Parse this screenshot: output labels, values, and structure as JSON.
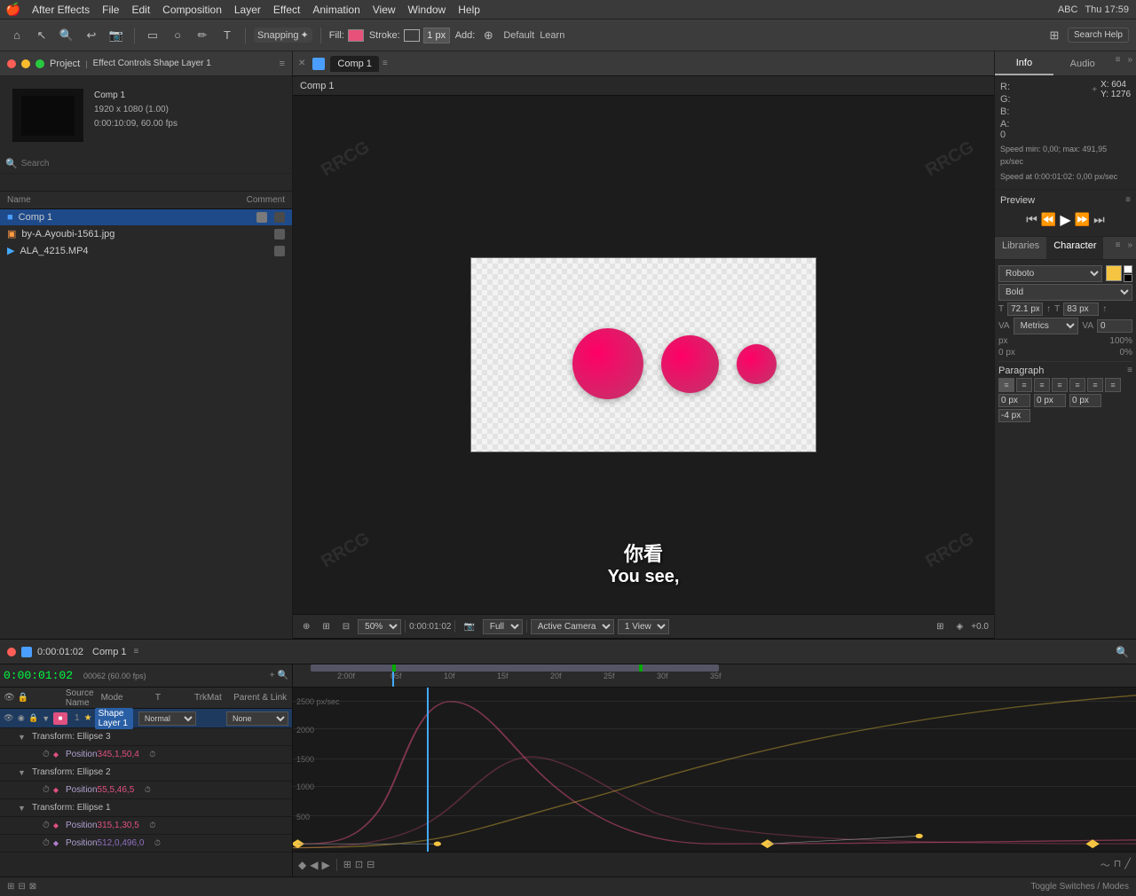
{
  "menubar": {
    "apple": "🍎",
    "items": [
      "After Effects",
      "File",
      "Edit",
      "Composition",
      "Layer",
      "Effect",
      "Animation",
      "View",
      "Window",
      "Help"
    ],
    "right_items": [
      "ABC",
      "Thu 17:59"
    ]
  },
  "toolbar": {
    "snapping_label": "Snapping",
    "fill_label": "Fill:",
    "stroke_label": "Stroke:",
    "stroke_width": "1 px",
    "add_label": "Add:",
    "default_label": "Default",
    "learn_label": "Learn"
  },
  "left_panel": {
    "project_title": "Project",
    "effect_controls_title": "Effect Controls Shape Layer 1",
    "comp_name": "Comp 1",
    "comp_details": "1920 x 1080 (1.00)",
    "comp_duration": "0:00:10:09, 60.00 fps",
    "file_columns": [
      "Name",
      "Comment"
    ],
    "files": [
      {
        "name": "Comp 1",
        "type": "comp",
        "selected": true
      },
      {
        "name": "by-A.Ayoubi-1561.jpg",
        "type": "image"
      },
      {
        "name": "ALA_4215.MP4",
        "type": "video"
      }
    ]
  },
  "comp_view": {
    "tab_label": "Comp 1",
    "breadcrumb": "Comp 1",
    "subtitle_zh": "你看",
    "subtitle_en": "You see,",
    "zoom_level": "50%",
    "timecode": "0:00:01:02",
    "resolution": "Full",
    "view_type": "Active Camera",
    "views": "1 View",
    "offset": "+0.0"
  },
  "right_panel": {
    "info_tab": "Info",
    "audio_tab": "Audio",
    "r_value": "R:",
    "g_value": "G:",
    "b_value": "B:",
    "a_value": "A: 0",
    "x_coord": "X: 604",
    "y_coord": "Y: 1276",
    "speed_min": "Speed min: 0,00; max: 491,95 px/sec",
    "speed_at": "Speed at 0:00:01:02: 0,00 px/sec",
    "preview_title": "Preview",
    "libraries_tab": "Libraries",
    "character_tab": "Character",
    "font_name": "Roboto",
    "font_style": "Bold",
    "font_size": "72.1 px",
    "font_size2": "83 px",
    "tracking_label": "Metrics",
    "tracking_value": "0",
    "unit_px": "px",
    "size_100": "100%",
    "size_0": "0%",
    "size_0b": "0 px",
    "size_0c": "0 px",
    "paragraph_title": "Paragraph",
    "indent_values": [
      "0 px",
      "0 px",
      "0 px"
    ],
    "para_spacing": [
      "-4 px"
    ]
  },
  "timeline": {
    "timecode": "0:00:01:02",
    "subcode": "00062 (60.00 fps)",
    "layer_col": "Source Name",
    "mode_col": "Mode",
    "t_col": "T",
    "trk_col": "TrkMat",
    "parent_col": "Parent & Link",
    "layer_name": "Shape Layer 1",
    "layer_mode": "Normal",
    "parent_val": "None",
    "transform_ellipse3": "Transform: Ellipse 3",
    "position3_label": "Position",
    "position3_val": "345,1,50,4",
    "transform_ellipse2": "Transform: Ellipse 2",
    "position2_label": "Position",
    "position2_val": "55,5,46,5",
    "transform_ellipse1": "Transform: Ellipse 1",
    "position1_label": "Position",
    "position1_val": "315,1,30,5",
    "position_label": "Position",
    "position_val": "512,0,496,0",
    "graph_values": [
      "2500 px/sec",
      "2000",
      "1500",
      "1000",
      "500"
    ],
    "ruler_marks": [
      "2:00f",
      "05f",
      "10f",
      "15f",
      "20f",
      "25f",
      "30f",
      "35f"
    ],
    "bottom_label": "Toggle Switches / Modes"
  }
}
